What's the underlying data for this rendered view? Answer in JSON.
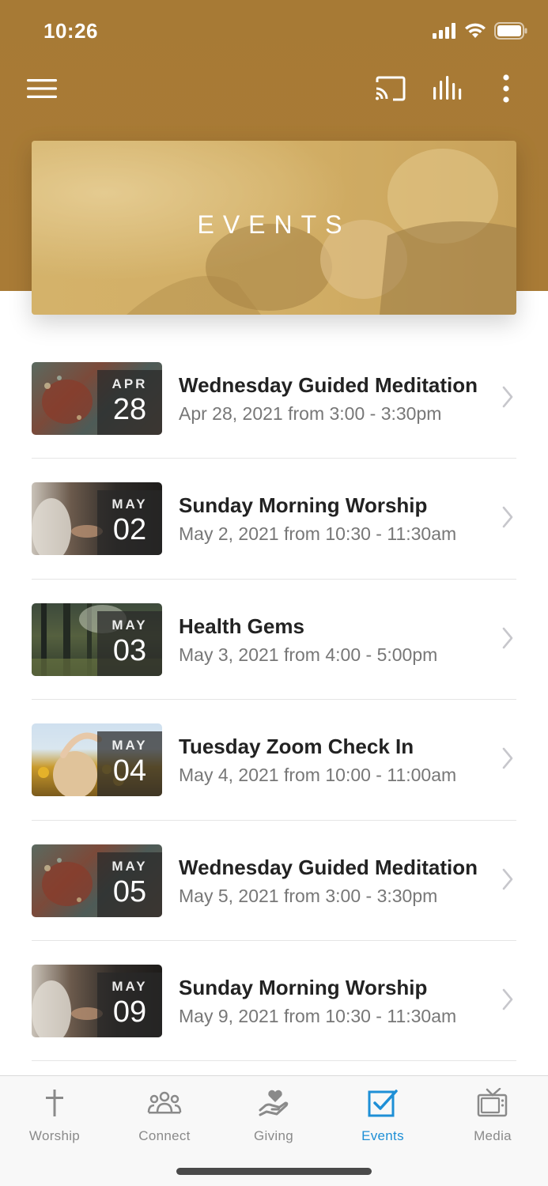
{
  "status_bar": {
    "time": "10:26"
  },
  "colors": {
    "header": "#a77a35",
    "accent": "#1e8fd6",
    "text": "#222222",
    "muted": "#777777"
  },
  "header": {
    "icons": [
      "menu-icon",
      "cast-icon",
      "audio-levels-icon",
      "more-vertical-icon"
    ],
    "hero_title": "EVENTS"
  },
  "events": [
    {
      "month": "APR",
      "day": "28",
      "title": "Wednesday Guided Meditation",
      "subtitle": "Apr 28, 2021 from 3:00 - 3:30pm"
    },
    {
      "month": "MAY",
      "day": "02",
      "title": "Sunday Morning Worship",
      "subtitle": "May 2, 2021 from 10:30 - 11:30am"
    },
    {
      "month": "MAY",
      "day": "03",
      "title": "Health Gems",
      "subtitle": "May 3, 2021 from 4:00 - 5:00pm"
    },
    {
      "month": "MAY",
      "day": "04",
      "title": "Tuesday Zoom Check In",
      "subtitle": "May 4, 2021 from 10:00 - 11:00am"
    },
    {
      "month": "MAY",
      "day": "05",
      "title": "Wednesday Guided Meditation",
      "subtitle": "May 5, 2021 from 3:00 - 3:30pm"
    },
    {
      "month": "MAY",
      "day": "09",
      "title": "Sunday Morning Worship",
      "subtitle": "May 9, 2021 from 10:30 - 11:30am"
    }
  ],
  "tabs": [
    {
      "label": "Worship",
      "icon": "cross-icon",
      "active": false
    },
    {
      "label": "Connect",
      "icon": "people-icon",
      "active": false
    },
    {
      "label": "Giving",
      "icon": "giving-hand-heart-icon",
      "active": false
    },
    {
      "label": "Events",
      "icon": "checkbox-icon",
      "active": true
    },
    {
      "label": "Media",
      "icon": "tv-icon",
      "active": false
    }
  ]
}
